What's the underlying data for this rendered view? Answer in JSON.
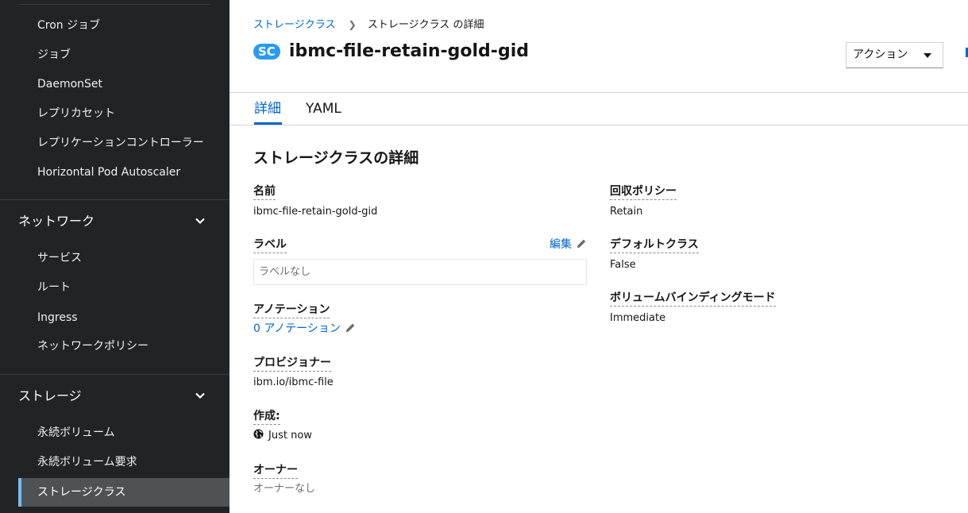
{
  "sidebar": {
    "workloads_items": [
      {
        "label": "Cron ジョブ"
      },
      {
        "label": "ジョブ"
      },
      {
        "label": "DaemonSet"
      },
      {
        "label": "レプリカセット"
      },
      {
        "label": "レプリケーションコントローラー"
      },
      {
        "label": "Horizontal Pod Autoscaler"
      }
    ],
    "network": {
      "label": "ネットワーク",
      "items": [
        {
          "label": "サービス"
        },
        {
          "label": "ルート"
        },
        {
          "label": "Ingress"
        },
        {
          "label": "ネットワークポリシー"
        }
      ]
    },
    "storage": {
      "label": "ストレージ",
      "items": [
        {
          "label": "永続ボリューム"
        },
        {
          "label": "永続ボリューム要求"
        },
        {
          "label": "ストレージクラス"
        }
      ]
    },
    "active_item": "ストレージクラス"
  },
  "breadcrumb": {
    "parent": "ストレージクラス",
    "current": "ストレージクラス の詳細"
  },
  "header": {
    "badge": "SC",
    "title": "ibmc-file-retain-gold-gid",
    "actions_label": "アクション"
  },
  "tabs": [
    {
      "label": "詳細",
      "active": true
    },
    {
      "label": "YAML",
      "active": false
    }
  ],
  "details": {
    "section_title": "ストレージクラスの詳細",
    "name_label": "名前",
    "name_value": "ibmc-file-retain-gold-gid",
    "labels_label": "ラベル",
    "labels_edit": "編集",
    "labels_value": "ラベルなし",
    "annotations_label": "アノテーション",
    "annotations_value": "0 アノテーション",
    "provisioner_label": "プロビジョナー",
    "provisioner_value": "ibm.io/ibmc-file",
    "created_label": "作成:",
    "created_value": "Just now",
    "owner_label": "オーナー",
    "owner_value": "オーナーなし",
    "reclaim_label": "回収ポリシー",
    "reclaim_value": "Retain",
    "default_label": "デフォルトクラス",
    "default_value": "False",
    "binding_label": "ボリュームバインディングモード",
    "binding_value": "Immediate"
  },
  "colors": {
    "sidebar_bg": "#212427",
    "active_bg": "#4f5255",
    "active_accent": "#73bcf7",
    "link": "#0066cc",
    "badge": "#2b9af3"
  },
  "icons": {
    "chevron": "chevron-down-icon",
    "pencil": "pencil-icon",
    "globe": "globe-icon",
    "breadcrumb_sep": "angle-right-icon",
    "caret": "caret-down-icon"
  }
}
